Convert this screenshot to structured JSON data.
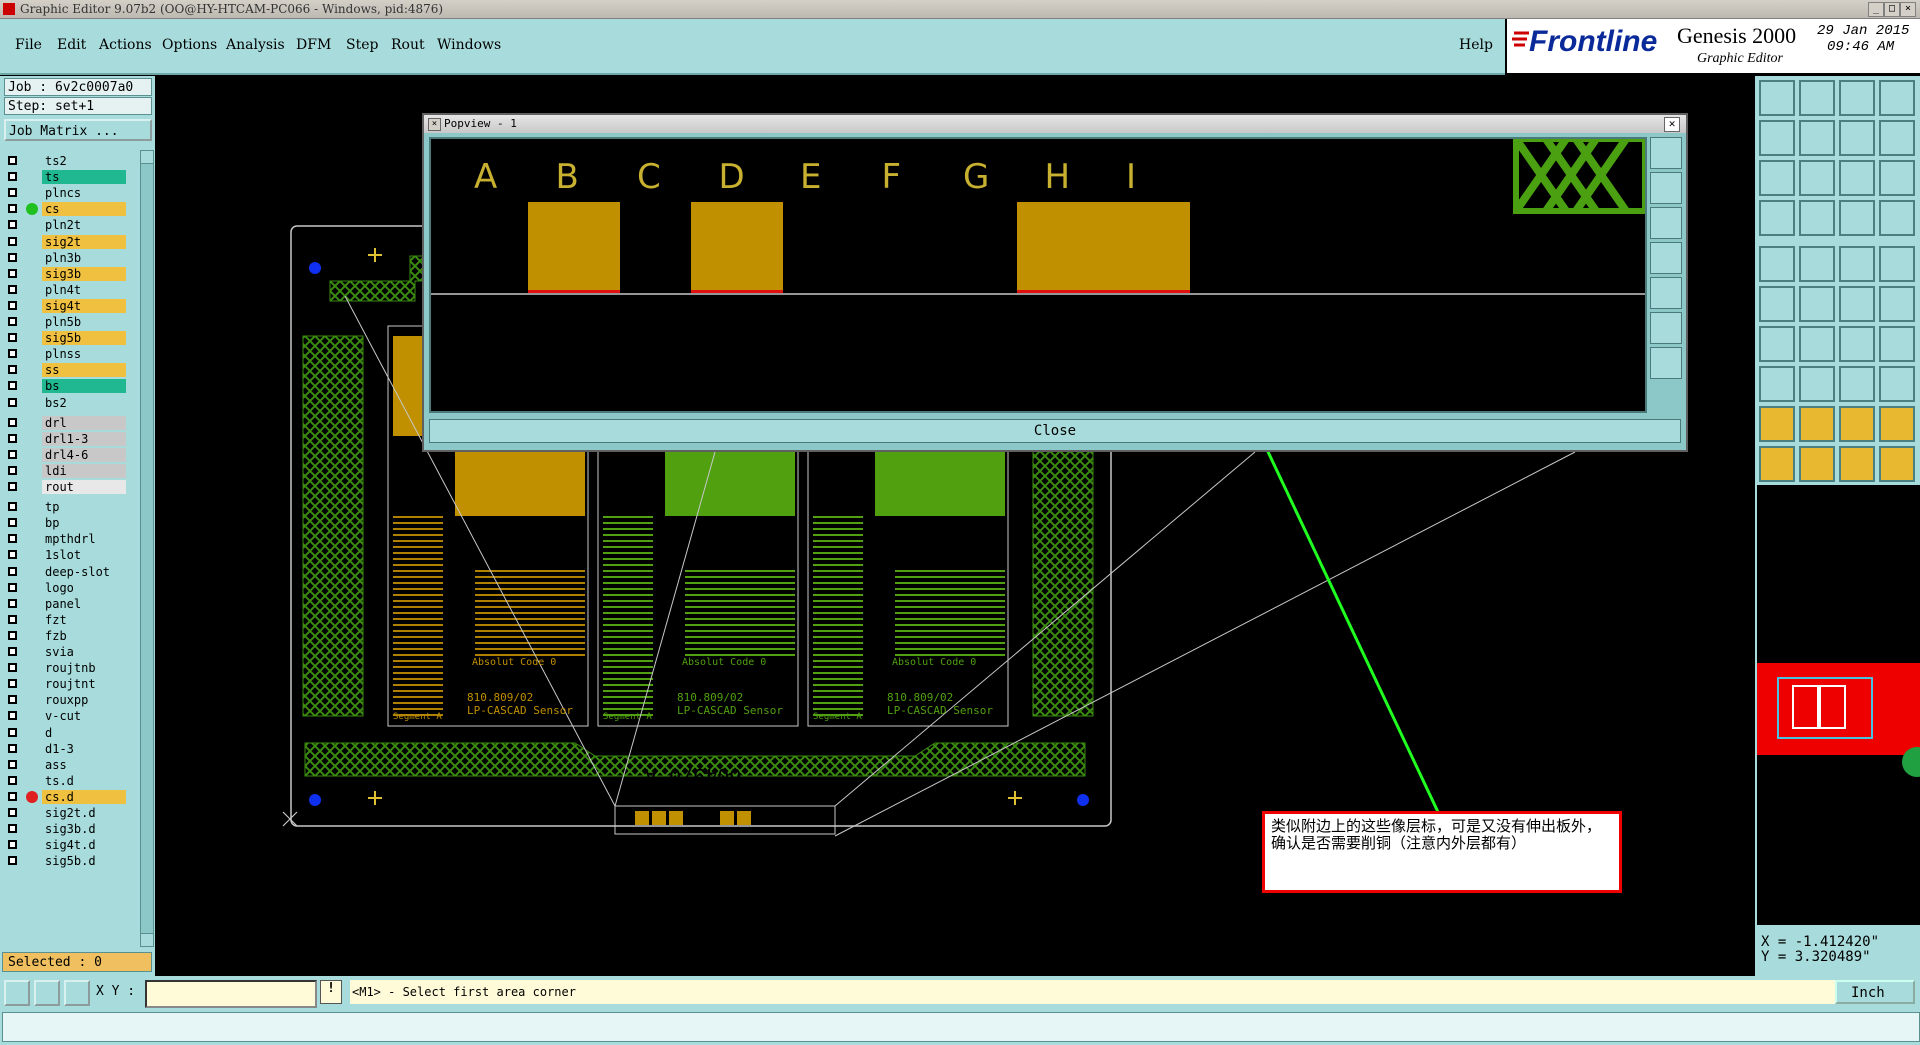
{
  "window": {
    "title": "Graphic Editor 9.07b2 (OO@HY-HTCAM-PC066 - Windows, pid:4876)"
  },
  "menu": [
    "File",
    "Edit",
    "Actions",
    "Options",
    "Analysis",
    "DFM",
    "Step",
    "Rout",
    "Windows"
  ],
  "help": "Help",
  "brand": {
    "logo": "Frontline",
    "product": "Genesis 2000",
    "subtitle": "Graphic Editor",
    "date": "29 Jan 2015",
    "time": "09:46 AM"
  },
  "job": {
    "job_line": "Job : 6v2c0007a0",
    "step_line": "Step: set+1",
    "matrix_button": "Job Matrix ..."
  },
  "layers": [
    {
      "name": "ts2",
      "color": "#a8dcdc"
    },
    {
      "name": "ts",
      "color": "#20b890"
    },
    {
      "name": "plncs",
      "color": "#a8dcdc"
    },
    {
      "name": "cs",
      "color": "#f0c040",
      "dot": "#20c020"
    },
    {
      "name": "pln2t",
      "color": "#a8dcdc"
    },
    {
      "name": "sig2t",
      "color": "#f0c040"
    },
    {
      "name": "pln3b",
      "color": "#a8dcdc"
    },
    {
      "name": "sig3b",
      "color": "#f0c040"
    },
    {
      "name": "pln4t",
      "color": "#a8dcdc"
    },
    {
      "name": "sig4t",
      "color": "#f0c040"
    },
    {
      "name": "pln5b",
      "color": "#a8dcdc"
    },
    {
      "name": "sig5b",
      "color": "#f0c040"
    },
    {
      "name": "plnss",
      "color": "#a8dcdc"
    },
    {
      "name": "ss",
      "color": "#f0c040"
    },
    {
      "name": "bs",
      "color": "#20b890"
    },
    {
      "name": "bs2",
      "color": "#a8dcdc"
    },
    {
      "name": "drl",
      "color": "#c8c8c8"
    },
    {
      "name": "drl1-3",
      "color": "#c8c8c8"
    },
    {
      "name": "drl4-6",
      "color": "#c8c8c8"
    },
    {
      "name": "ldi",
      "color": "#c8c8c8"
    },
    {
      "name": "rout",
      "color": "#e8e8e8"
    },
    {
      "name": "tp",
      "color": "#a8dcdc"
    },
    {
      "name": "bp",
      "color": "#a8dcdc"
    },
    {
      "name": "mpthdrl",
      "color": "#a8dcdc"
    },
    {
      "name": "1slot",
      "color": "#a8dcdc"
    },
    {
      "name": "deep-slot",
      "color": "#a8dcdc"
    },
    {
      "name": "logo",
      "color": "#a8dcdc"
    },
    {
      "name": "panel",
      "color": "#a8dcdc"
    },
    {
      "name": "fzt",
      "color": "#a8dcdc"
    },
    {
      "name": "fzb",
      "color": "#a8dcdc"
    },
    {
      "name": "svia",
      "color": "#a8dcdc"
    },
    {
      "name": "roujtnb",
      "color": "#a8dcdc"
    },
    {
      "name": "roujtnt",
      "color": "#a8dcdc"
    },
    {
      "name": "rouxpp",
      "color": "#a8dcdc"
    },
    {
      "name": "v-cut",
      "color": "#a8dcdc"
    },
    {
      "name": "d",
      "color": "#a8dcdc"
    },
    {
      "name": "d1-3",
      "color": "#a8dcdc"
    },
    {
      "name": "ass",
      "color": "#a8dcdc"
    },
    {
      "name": "ts.d",
      "color": "#a8dcdc"
    },
    {
      "name": "cs.d",
      "color": "#f0c040",
      "dot": "#e02020"
    },
    {
      "name": "sig2t.d",
      "color": "#a8dcdc"
    },
    {
      "name": "sig3b.d",
      "color": "#a8dcdc"
    },
    {
      "name": "sig4t.d",
      "color": "#a8dcdc"
    },
    {
      "name": "sig5b.d",
      "color": "#a8dcdc"
    }
  ],
  "selected": "Selected : 0",
  "popup": {
    "title": "Popview - 1",
    "letters": [
      "A",
      "B",
      "C",
      "D",
      "E",
      "F",
      "G",
      "H",
      "I"
    ],
    "filled": [
      false,
      true,
      false,
      true,
      false,
      false,
      false,
      true,
      true
    ],
    "close_label": "Close"
  },
  "board": {
    "absolut_code": "Absolut Code 0",
    "part_no": "810.809/02",
    "sensor": "LP-CASCAD Sensor",
    "segment": "Segment A",
    "mirrored_code": "6049/0 A"
  },
  "annotation": "类似附边上的这些像层标，可是又没有伸出板外，确认是否需要削铜（注意内外层都有）",
  "coords": {
    "x": "X = -1.412420\"",
    "y": "Y = 3.320489\""
  },
  "bottom": {
    "xy_label": "X Y :",
    "message": "<M1> - Select first area corner",
    "unit": "Inch"
  },
  "colors": {
    "panel": "#a8dcdc",
    "copper_gold": "#c09000",
    "copper_green": "#50a010",
    "pointer": "#20ff20"
  }
}
